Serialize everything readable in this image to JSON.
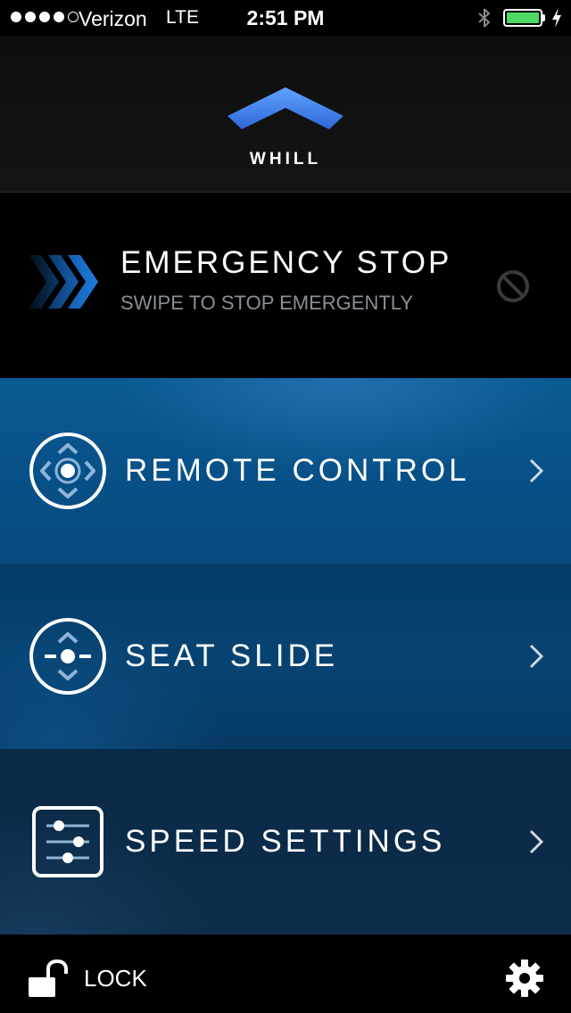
{
  "status_bar": {
    "carrier": "Verizon",
    "network": "LTE",
    "time": "2:51 PM",
    "signal_bars": 4,
    "signal_total": 5,
    "battery_color": "#4cd964",
    "icons": [
      "bluetooth-icon",
      "battery-icon",
      "charging-icon"
    ]
  },
  "header": {
    "logo_text": "WHILL",
    "logo_color": "#4f8cf0"
  },
  "emergency": {
    "title": "EMERGENCY STOP",
    "subtitle": "SWIPE TO STOP EMERGENTLY",
    "arrow_color": "#1b6fd0",
    "icons": [
      "swipe-arrows-icon",
      "stop-icon"
    ]
  },
  "menu": {
    "items": [
      {
        "label": "REMOTE CONTROL",
        "icon": "remote-control-icon"
      },
      {
        "label": "SEAT SLIDE",
        "icon": "seat-slide-icon"
      },
      {
        "label": "SPEED SETTINGS",
        "icon": "speed-settings-icon"
      }
    ]
  },
  "bottom_bar": {
    "lock_label": "LOCK",
    "icons": [
      "unlock-icon",
      "gear-icon"
    ]
  }
}
